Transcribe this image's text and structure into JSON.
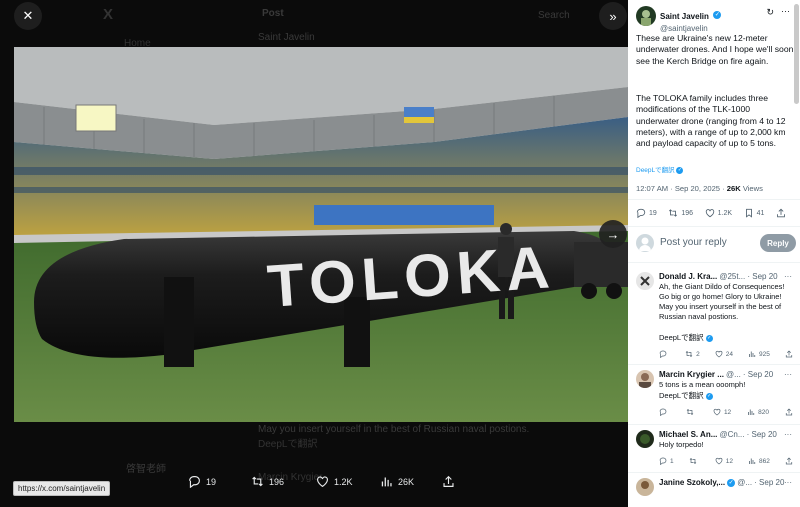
{
  "viewer": {
    "close_icon": "close-icon",
    "collapse_icon": "double-chevron-right-icon",
    "next_icon": "arrow-right-icon",
    "photo_text": "TOLOKA",
    "url_tooltip": "https://x.com/saintjavelin",
    "stats": {
      "replies": "19",
      "reposts": "196",
      "likes": "1.2K",
      "views": "26K"
    },
    "background": {
      "logo": "X",
      "home": "Home",
      "post_header": "Post",
      "search": "Search",
      "author": "Saint Javelin",
      "reply_snippet": "May you insert yourself in the best of Russian naval postions.",
      "translate": "DeepLで翻訳",
      "account_name": "啓智老師",
      "reply_author": "Marcin Krygier"
    }
  },
  "post": {
    "author": "Saint Javelin",
    "handle": "@saintjavelin",
    "paragraph1": "These are Ukraine's new 12-meter underwater drones. And I hope we'll soon see the Kerch Bridge on fire again.",
    "paragraph2": "The TOLOKA family includes three modifications of the TLK-1000 underwater drone (ranging from 4 to 12 meters), with a range of up to 2,000 km and payload capacity of up to 5 tons.",
    "translate": "DeepLで翻訳",
    "time": "12:07 AM · Sep 20, 2025 · ",
    "views_count": "26K",
    "views_label": " Views",
    "stats": {
      "replies": "19",
      "reposts": "196",
      "likes": "1.2K",
      "bookmarks": "41"
    }
  },
  "reply_box": {
    "placeholder": "Post your reply",
    "button": "Reply"
  },
  "replies": [
    {
      "name": "Donald J. Kra...",
      "handle": "@25t...",
      "date": "· Sep 20",
      "text": "Ah, the Giant Dildo of Consequences! Go big or go home! Glory to Ukraine! May you insert yourself in the best of Russian naval postions.",
      "translate": "DeepLで翻訳",
      "stats": {
        "replies": "",
        "reposts": "2",
        "likes": "24",
        "views": "925"
      }
    },
    {
      "name": "Marcin Krygier ...",
      "handle": "@...",
      "date": "· Sep 20",
      "text": "5 tons is a mean ooomph!",
      "translate": "DeepLで翻訳",
      "stats": {
        "replies": "",
        "reposts": "",
        "likes": "12",
        "views": "820"
      }
    },
    {
      "name": "Michael S. An...",
      "handle": "@Cn...",
      "date": "· Sep 20",
      "text": "Holy torpedo!",
      "stats": {
        "replies": "1",
        "reposts": "",
        "likes": "12",
        "views": "862"
      }
    },
    {
      "name": "Janine Szokoly,...",
      "handle": "@...",
      "date": "· Sep 20",
      "text": ""
    }
  ],
  "colors": {
    "accent": "#1d9bf0",
    "text": "#0f1419",
    "muted": "#536471",
    "viewer_bg": "#0b0b0b"
  }
}
